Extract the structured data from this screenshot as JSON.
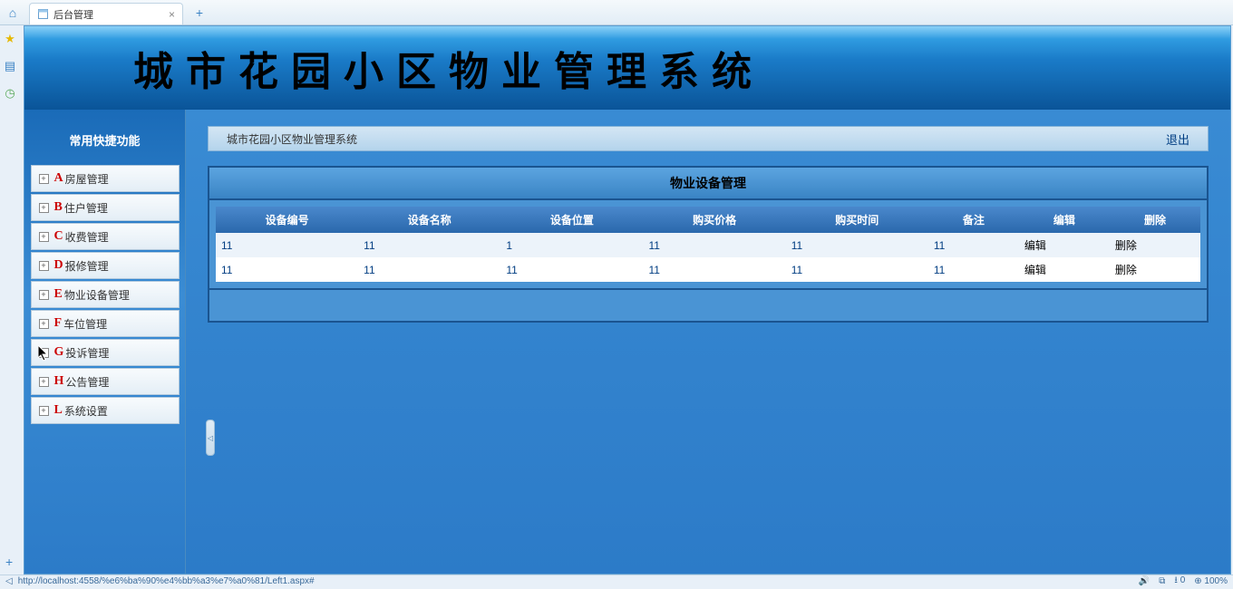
{
  "browser": {
    "tab_title": "后台管理",
    "status_url": "http://localhost:4558/%e6%ba%90%e4%bb%a3%e7%a0%81/Left1.aspx#",
    "zoom": "100%",
    "download_count": "0"
  },
  "app": {
    "title": "城市花园小区物业管理系统",
    "breadcrumb": "城市花园小区物业管理系统",
    "logout": "退出"
  },
  "sidebar": {
    "title": "常用快捷功能",
    "items": [
      {
        "letter": "A",
        "label": "房屋管理"
      },
      {
        "letter": "B",
        "label": "住户管理"
      },
      {
        "letter": "C",
        "label": "收费管理"
      },
      {
        "letter": "D",
        "label": "报修管理"
      },
      {
        "letter": "E",
        "label": "物业设备管理"
      },
      {
        "letter": "F",
        "label": "车位管理"
      },
      {
        "letter": "G",
        "label": "投诉管理"
      },
      {
        "letter": "H",
        "label": "公告管理"
      },
      {
        "letter": "L",
        "label": "系统设置"
      }
    ]
  },
  "panel": {
    "title": "物业设备管理",
    "columns": [
      "设备编号",
      "设备名称",
      "设备位置",
      "购买价格",
      "购买时间",
      "备注",
      "编辑",
      "删除"
    ],
    "rows": [
      {
        "c0": "11",
        "c1": "11",
        "c2": "1",
        "c3": "11",
        "c4": "11",
        "c5": "11",
        "edit": "编辑",
        "del": "删除"
      },
      {
        "c0": "11",
        "c1": "11",
        "c2": "11",
        "c3": "11",
        "c4": "11",
        "c5": "11",
        "edit": "编辑",
        "del": "删除"
      }
    ]
  }
}
